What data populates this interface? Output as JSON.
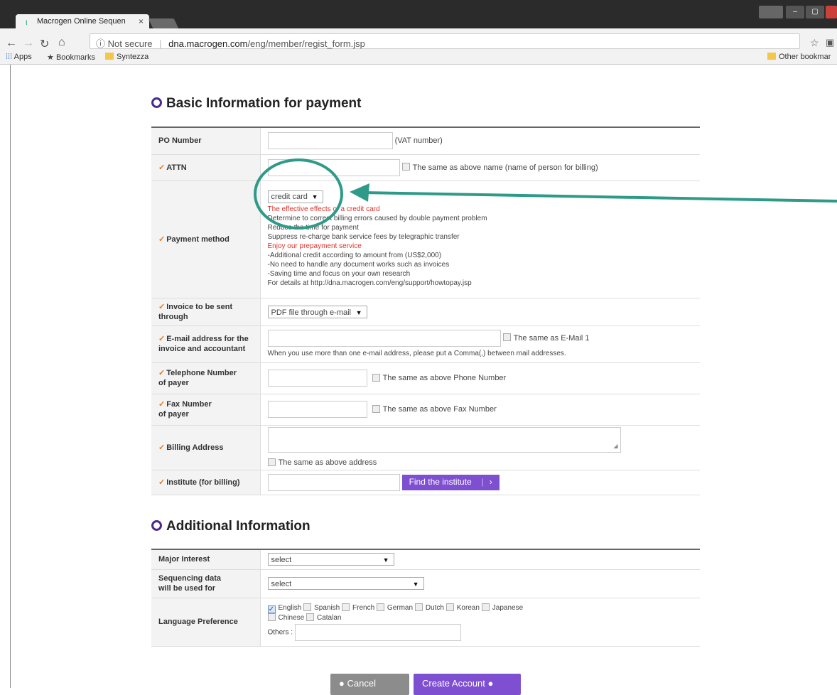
{
  "browser": {
    "tab_title": "Macrogen Online Sequen",
    "tab_close": "×",
    "security_label": "Not secure",
    "url_host": "dna.macrogen.com",
    "url_path": "/eng/member/regist_form.jsp",
    "bookmarks": [
      "Apps",
      "Bookmarks",
      "Syntezza"
    ],
    "other_bookmarks": "Other bookmar"
  },
  "payment": {
    "title": "Basic Information for payment",
    "po_label": "PO Number",
    "po_hint": "(VAT number)",
    "attn_label": "ATTN",
    "attn_same": "The same as above name (name of person for billing)",
    "method_label": "Payment method",
    "method_selected": "credit card",
    "method_lines": [
      {
        "text": "The effective effects of a credit card",
        "red": true
      },
      {
        "text": "Determine to correct billing errors caused by double payment problem",
        "red": false
      },
      {
        "text": "Reduce the time for payment",
        "red": false
      },
      {
        "text": "Suppress re-charge bank service fees by telegraphic transfer",
        "red": false
      },
      {
        "text": "Enjoy our prepayment service",
        "red": true
      },
      {
        "text": "-Additional credit according to amount from (US$2,000)",
        "red": false
      },
      {
        "text": "-No need to handle any document works such as invoices",
        "red": false
      },
      {
        "text": "-Saving time and focus on your own research",
        "red": false
      },
      {
        "text": "For details at http://dna.macrogen.com/eng/support/howtopay.jsp",
        "red": false
      }
    ],
    "invoice_label_1": "Invoice to be sent",
    "invoice_label_2": "through",
    "invoice_selected": "PDF file through e-mail",
    "email_label_1": "E-mail address for the",
    "email_label_2": "invoice and accountant",
    "email_same": "The same as E-Mail 1",
    "email_hint": "When you use more than one e-mail address, please put a Comma(,) between mail addresses.",
    "tel_label_1": "Telephone Number",
    "tel_label_2": "of payer",
    "tel_same": "The same as above Phone Number",
    "fax_label_1": "Fax Number",
    "fax_label_2": "of payer",
    "fax_same": "The same as above Fax Number",
    "billing_label": "Billing Address",
    "billing_same": "The same as above address",
    "institute_label": "Institute (for billing)",
    "find_institute": "Find the institute",
    "find_arrow": "›"
  },
  "additional": {
    "title": "Additional Information",
    "interest_label": "Major Interest",
    "interest_selected": "select",
    "seq_label_1": "Sequencing data",
    "seq_label_2": "will be used for",
    "seq_selected": "select",
    "lang_label": "Language Preference",
    "languages": [
      {
        "name": "English",
        "checked": true
      },
      {
        "name": "Spanish",
        "checked": false
      },
      {
        "name": "French",
        "checked": false
      },
      {
        "name": "German",
        "checked": false
      },
      {
        "name": "Dutch",
        "checked": false
      },
      {
        "name": "Korean",
        "checked": false
      },
      {
        "name": "Japanese",
        "checked": false
      },
      {
        "name": "Chinese",
        "checked": false
      },
      {
        "name": "Catalan",
        "checked": false
      }
    ],
    "others_label": "Others :"
  },
  "buttons": {
    "cancel": "Cancel",
    "create": "Create Account"
  },
  "colors": {
    "accent_purple": "#7f4fd1",
    "annotation_teal": "#2e9a88",
    "required_mark": "#e37a21",
    "alert_red": "#e0322b"
  }
}
